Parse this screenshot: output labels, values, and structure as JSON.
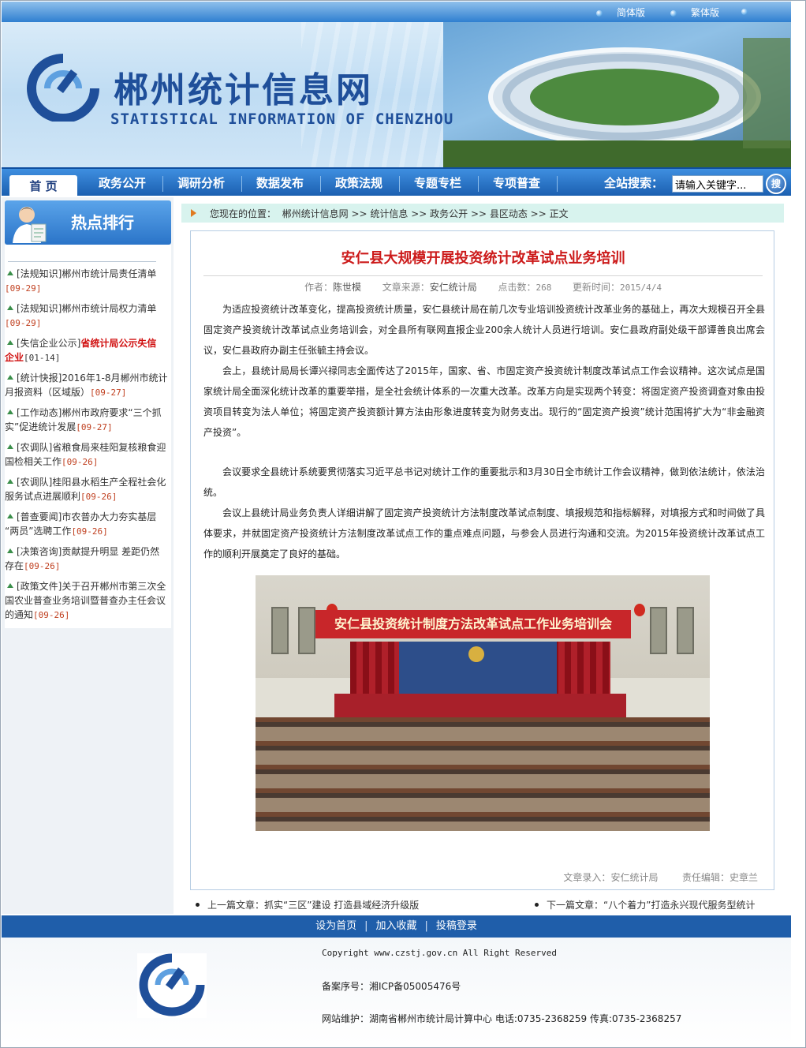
{
  "top_bar": {
    "lang_simplified": "简体版",
    "lang_traditional": "繁体版"
  },
  "banner": {
    "title": "郴州统计信息网",
    "subtitle": "STATISTICAL INFORMATION OF CHENZHOU"
  },
  "nav": {
    "items": [
      "首 页",
      "政务公开",
      "调研分析",
      "数据发布",
      "政策法规",
      "专题专栏",
      "专项普查"
    ],
    "search_label": "全站搜索：",
    "search_value": "请输入关键字...",
    "search_button": "搜"
  },
  "sidebar": {
    "title": "热点排行",
    "items": [
      {
        "line1": "[法规知识]郴州市统计局责任清单",
        "line2": "",
        "date": "[09-29]"
      },
      {
        "line1": "[法规知识]郴州市统计局权力清单",
        "line2": "",
        "date": "[09-29]"
      },
      {
        "line1_prefix": "[失信企业公示]",
        "line1_red": "省统计局公示失信",
        "line2_red": "企业",
        "date": "[01-14]"
      },
      {
        "line1": "[统计快报]2016年1-8月郴州市统计",
        "line2": "月报资料（区域版）",
        "date": "[09-27]"
      },
      {
        "line1": "[工作动态]郴州市政府要求“三个抓",
        "line2": "实”促进统计发展",
        "date": "[09-27]"
      },
      {
        "line1": "[农调队]省粮食局来桂阳复核粮食迎",
        "line2": "国检相关工作",
        "date": "[09-26]"
      },
      {
        "line1": "[农调队]桂阳县水稻生产全程社会化",
        "line2": "服务试点进展顺利",
        "date": "[09-26]"
      },
      {
        "line1": "[普查要闻]市农普办大力夯实基层",
        "line2": "“两员”选聘工作",
        "date": "[09-26]"
      },
      {
        "line1": "[决策咨询]贡献提升明显  差距仍然",
        "line2": "存在",
        "date": "[09-26]"
      },
      {
        "line1": "[政策文件]关于召开郴州市第三次全",
        "line2": "国农业普查业务培训暨普查办主任会议",
        "line3": "的通知",
        "date": "[09-26]"
      }
    ]
  },
  "breadcrumb": {
    "prefix": "您现在的位置：",
    "path": "郴州统计信息网 >> 统计信息 >> 政务公开 >> 县区动态 >> 正文"
  },
  "article": {
    "title": "安仁县大规模开展投资统计改革试点业务培训",
    "meta": {
      "author_label": "作者：",
      "author": "陈世模",
      "source_label": "文章来源：",
      "source": "安仁统计局",
      "hits_label": "点击数：",
      "hits": "268",
      "updated_label": "更新时间：",
      "updated": "2015/4/4"
    },
    "paragraphs": [
      "为适应投资统计改革变化，提高投资统计质量，安仁县统计局在前几次专业培训投资统计改革业务的基础上，再次大规模召开全县固定资产投资统计改革试点业务培训会，对全县所有联网直报企业200余人统计人员进行培训。安仁县政府副处级干部谭善良出席会议，安仁县政府办副主任张毓主持会议。",
      "会上，县统计局局长谭兴禄同志全面传达了2015年，国家、省、市固定资产投资统计制度改革试点工作会议精神。这次试点是国家统计局全面深化统计改革的重要举措，是全社会统计体系的一次重大改革。改革方向是实现两个转变：将固定资产投资调查对象由投资项目转变为法人单位；将固定资产投资额计算方法由形象进度转变为财务支出。现行的“固定资产投资”统计范围将扩大为“非金融资产投资”。",
      "会议要求全县统计系统要贯彻落实习近平总书记对统计工作的重要批示和3月30日全市统计工作会议精神，做到依法统计，依法治统。",
      "会议上县统计局业务负责人详细讲解了固定资产投资统计方法制度改革试点制度、填报规范和指标解释，对填报方式和时间做了具体要求，并就固定资产投资统计方法制度改革试点工作的重点难点问题，与参会人员进行沟通和交流。为2015年投资统计改革试点工作的顺利开展奠定了良好的基础。"
    ],
    "photo_banner": "安仁县投资统计制度方法改革试点工作业务培训会",
    "footer": {
      "entry_label": "文章录入：",
      "entry": "安仁统计局",
      "editor_label": "责任编辑：",
      "editor": "史章兰"
    }
  },
  "prev_next": {
    "prev_label": "上一篇文章：",
    "prev": "抓实“三区”建设  打造县域经济升级版",
    "next_label": "下一篇文章：",
    "next": "“八个着力”打造永兴现代服务型统计"
  },
  "footer": {
    "links": [
      "设为首页",
      "加入收藏",
      "投稿登录"
    ],
    "copyright": "Copyright www.czstj.gov.cn All Right Reserved",
    "icp": "备案序号：湘ICP备05005476号",
    "maintain": "网站维护：湖南省郴州市统计局计算中心 电话:0735-2368259 传真:0735-2368257"
  },
  "colors": {
    "nav_blue": "#1b5fb0",
    "title_red": "#cc1a1a",
    "date_red": "#c04020",
    "breadcrumb_bg": "#d8f3ee"
  },
  "icons": [
    "logo-icon",
    "avatar-icon",
    "search-icon",
    "bullet-triangle-icon",
    "breadcrumb-arrow-icon"
  ]
}
